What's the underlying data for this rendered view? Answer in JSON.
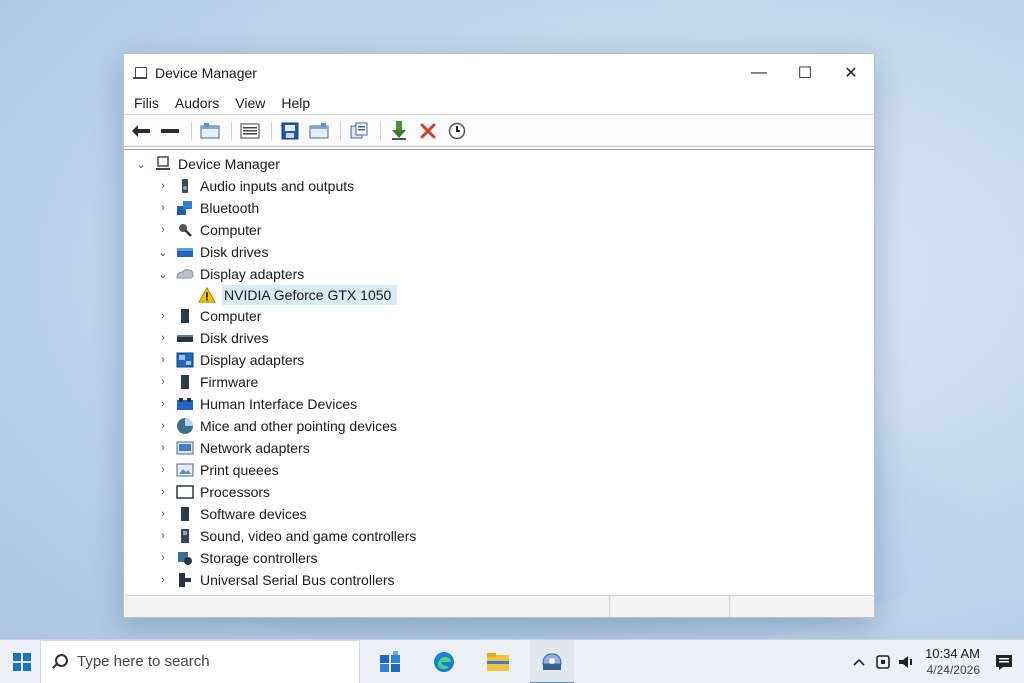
{
  "window": {
    "title": "Device Manager",
    "menu": [
      "Filis",
      "Audors",
      "View",
      "Help"
    ],
    "controls": {
      "minimize": "—",
      "maximize": "☐",
      "close": "✕"
    }
  },
  "toolbar": {
    "buttons": [
      "back-icon",
      "forward-icon",
      "show-hide-tree-icon",
      "properties-icon",
      "help-icon",
      "update-driver-icon",
      "scan-hardware-icon",
      "enable-device-icon",
      "uninstall-device-icon",
      "rollback-icon"
    ]
  },
  "tree": {
    "root": {
      "label": "Device Manager",
      "icon": "computer-icon"
    },
    "items": [
      {
        "label": "Audio inputs and outputs",
        "icon": "speaker-icon",
        "expanded": false
      },
      {
        "label": "Bluetooth",
        "icon": "bluetooth-icon",
        "expanded": false
      },
      {
        "label": "Computer",
        "icon": "computer-icon",
        "expanded": false
      },
      {
        "label": "Disk drives",
        "icon": "disk-icon",
        "expanded": true
      },
      {
        "label": "Display adapters",
        "icon": "display-adapter-icon",
        "expanded": true
      },
      {
        "label": "NVIDIA Geforce GTX 1050",
        "icon": "warning-icon",
        "child": true,
        "selected": true
      },
      {
        "label": "Computer",
        "icon": "computer-icon",
        "expanded": false
      },
      {
        "label": "Disk drives",
        "icon": "disk-icon",
        "expanded": false
      },
      {
        "label": "Display adapters",
        "icon": "monitor-icon",
        "expanded": false
      },
      {
        "label": "Firmware",
        "icon": "firmware-icon",
        "expanded": false
      },
      {
        "label": "Human Interface Devices",
        "icon": "hid-icon",
        "expanded": false
      },
      {
        "label": "Mice and other pointing devices",
        "icon": "mouse-icon",
        "expanded": false
      },
      {
        "label": "Network adapters",
        "icon": "network-icon",
        "expanded": false
      },
      {
        "label": "Print queees",
        "icon": "printer-icon",
        "expanded": false
      },
      {
        "label": "Processors",
        "icon": "processor-icon",
        "expanded": false
      },
      {
        "label": "Software devices",
        "icon": "software-icon",
        "expanded": false
      },
      {
        "label": "Sound, video and game controllers",
        "icon": "sound-icon",
        "expanded": false
      },
      {
        "label": "Storage controllers",
        "icon": "storage-icon",
        "expanded": false
      },
      {
        "label": "Universal Serial Bus controllers",
        "icon": "usb-icon",
        "expanded": false
      }
    ]
  },
  "taskbar": {
    "search_placeholder": "Type here to search",
    "apps": [
      "store-icon",
      "edge-icon",
      "file-explorer-icon",
      "device-manager-icon"
    ],
    "time": "10:34 AM",
    "date": "4/24/2026"
  },
  "colors": {
    "accent": "#1a73c8",
    "selection": "#dbe9f7",
    "warning": "#f2c200",
    "error": "#d83b2b"
  }
}
